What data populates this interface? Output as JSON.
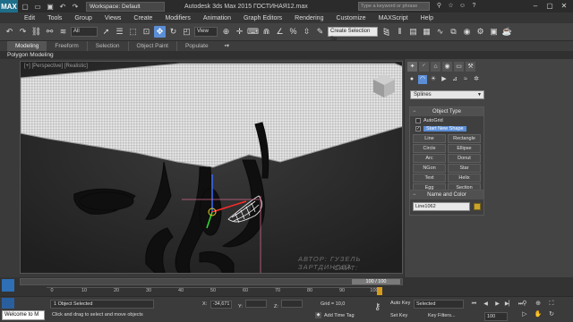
{
  "titlebar": {
    "logo": "MAX",
    "workspace": "Workspace: Default",
    "title": "Autodesk 3ds Max  2015     ГОСТИНАЯ12.max",
    "search_placeholder": "Type a keyword or phrase"
  },
  "menubar": [
    "Edit",
    "Tools",
    "Group",
    "Views",
    "Create",
    "Modifiers",
    "Animation",
    "Graph Editors",
    "Rendering",
    "Customize",
    "MAXScript",
    "Help"
  ],
  "toolbar": {
    "selection_filter": "All",
    "ref_coord": "View",
    "selection_set": "Create Selection Se"
  },
  "ribbon": {
    "tabs": [
      "Modeling",
      "Freeform",
      "Selection",
      "Object Paint",
      "Populate"
    ],
    "active": "Modeling",
    "subpanel": "Polygon Modeling"
  },
  "command_panel": {
    "category": "Splines",
    "object_type": {
      "title": "Object Type",
      "autogrid": "AutoGrid",
      "start_new_shape": "Start New Shape",
      "buttons": [
        "Line",
        "Rectangle",
        "Circle",
        "Ellipse",
        "Arc",
        "Donut",
        "NGon",
        "Star",
        "Text",
        "Helix",
        "Egg",
        "Section"
      ]
    },
    "name_color": {
      "title": "Name and Color",
      "name": "Line1062",
      "color": "#c9a32c"
    }
  },
  "viewport": {
    "label": "[+] [Perspective] [Realistic]",
    "watermark_line1": "АВТОР: ГУЗЕЛЬ ЗАРТДИНОВА",
    "watermark_line2": "САЙТ: GRAFOB.RU"
  },
  "timeline": {
    "frame_display": "100 / 100",
    "ticks": [
      "0",
      "10",
      "20",
      "30",
      "40",
      "50",
      "60",
      "70",
      "80",
      "90",
      "100"
    ]
  },
  "status": {
    "welcome": "Welcome to M",
    "selected": "1 Object Selected",
    "prompt": "Click and drag to select and move objects",
    "x_label": "X:",
    "x_value": "-34,671",
    "y_label": "Y:",
    "y_value": "",
    "z_label": "Z:",
    "z_value": "",
    "grid": "Grid = 10,0",
    "add_time_tag": "Add Time Tag",
    "auto_key": "Auto Key",
    "set_key": "Set Key",
    "selected_drop": "Selected",
    "key_filters": "Key Filters...",
    "frame_value": "100"
  }
}
